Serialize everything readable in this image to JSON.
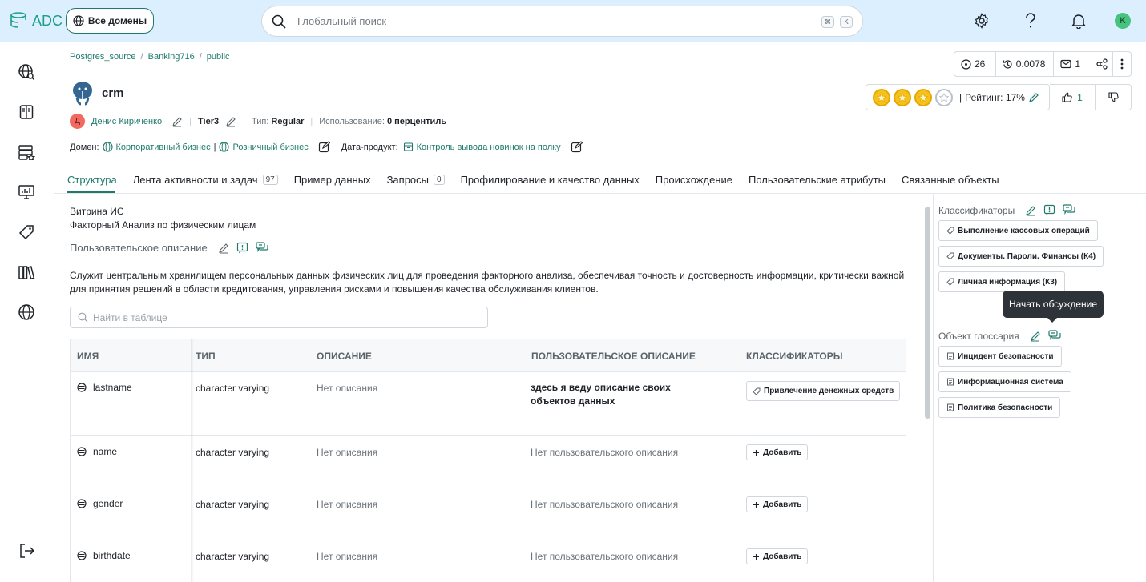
{
  "app": {
    "logo_text": "ADC"
  },
  "header": {
    "domains_label": "Все домены",
    "search_placeholder": "Глобальный поиск",
    "kbd_cmd": "⌘",
    "kbd_k": "K",
    "avatar_letter": "K"
  },
  "breadcrumb": [
    "Postgres_source",
    "/",
    "Banking716",
    "/",
    "public"
  ],
  "entity": {
    "title": "crm",
    "owner_initial": "Д",
    "owner": "Денис Кириченко",
    "tier": "Tier3",
    "type_label": "Тип:",
    "type_value": "Regular",
    "usage_label": "Использование:",
    "usage_value": "0 перцентиль",
    "domain_label": "Домен:",
    "domain_1": "Корпоративный бизнес",
    "domain_sep": "|",
    "domain_2": "Розничный бизнес",
    "product_label": "Дата-продукт:",
    "product_value": "Контроль вывода новинок на полку"
  },
  "stats": {
    "views": "26",
    "cost": "0.0078",
    "messages": "1"
  },
  "rating": {
    "stars_filled": 3,
    "stars_total": 4,
    "sep": "|",
    "label": "Рейтинг: 17%",
    "likes": "1"
  },
  "tabs": [
    {
      "label": "Структура",
      "count": ""
    },
    {
      "label": "Лента активности и задач",
      "count": "97"
    },
    {
      "label": "Пример данных",
      "count": ""
    },
    {
      "label": "Запросы",
      "count": "0"
    },
    {
      "label": "Профилирование и качество данных",
      "count": ""
    },
    {
      "label": "Происхождение",
      "count": ""
    },
    {
      "label": "Пользовательские атрибуты",
      "count": ""
    },
    {
      "label": "Связанные объекты",
      "count": ""
    }
  ],
  "description": {
    "line1": "Витрина ИС",
    "line2": "Факторный Анализ по физическим лицам",
    "user_desc_title": "Пользовательское описание",
    "user_desc": "Служит центральным хранилищем персональных данных физических лиц для проведения факторного анализа, обеспечивая точность и достоверность информации, критически важной для принятия решений в области кредитования, управления рисками и повышения качества обслуживания клиентов."
  },
  "table": {
    "search_placeholder": "Найти в таблице",
    "columns": [
      "ИМЯ",
      "ТИП",
      "ОПИСАНИЕ",
      "ПОЛЬЗОВАТЕЛЬСКОЕ ОПИСАНИЕ",
      "КЛАССИФИКАТОРЫ"
    ],
    "rows": [
      {
        "name": "lastname",
        "type": "character varying",
        "desc": "Нет описания",
        "user_desc": "здесь я веду описание своих объектов данных",
        "classifier": "Привлечение денежных средств"
      },
      {
        "name": "name",
        "type": "character varying",
        "desc": "Нет описания",
        "user_desc": "Нет пользовательского описания",
        "classifier": "Добавить"
      },
      {
        "name": "gender",
        "type": "character varying",
        "desc": "Нет описания",
        "user_desc": "Нет пользовательского описания",
        "classifier": "Добавить"
      },
      {
        "name": "birthdate",
        "type": "character varying",
        "desc": "Нет описания",
        "user_desc": "Нет пользовательского описания",
        "classifier": "Добавить"
      }
    ]
  },
  "side": {
    "classifiers_title": "Классификаторы",
    "classifiers": [
      "Выполнение кассовых операций",
      "Документы. Пароли. Финансы (К4)",
      "Личная информация (К3)"
    ],
    "tooltip": "Начать обсуждение",
    "glossary_title": "Объект глоссария",
    "glossary": [
      "Инцидент безопасности",
      "Информационная система",
      "Политика безопасности"
    ]
  },
  "colors": {
    "accent": "#1f7a6c",
    "topbar": "#dcefff",
    "star": "#f4c21f"
  }
}
